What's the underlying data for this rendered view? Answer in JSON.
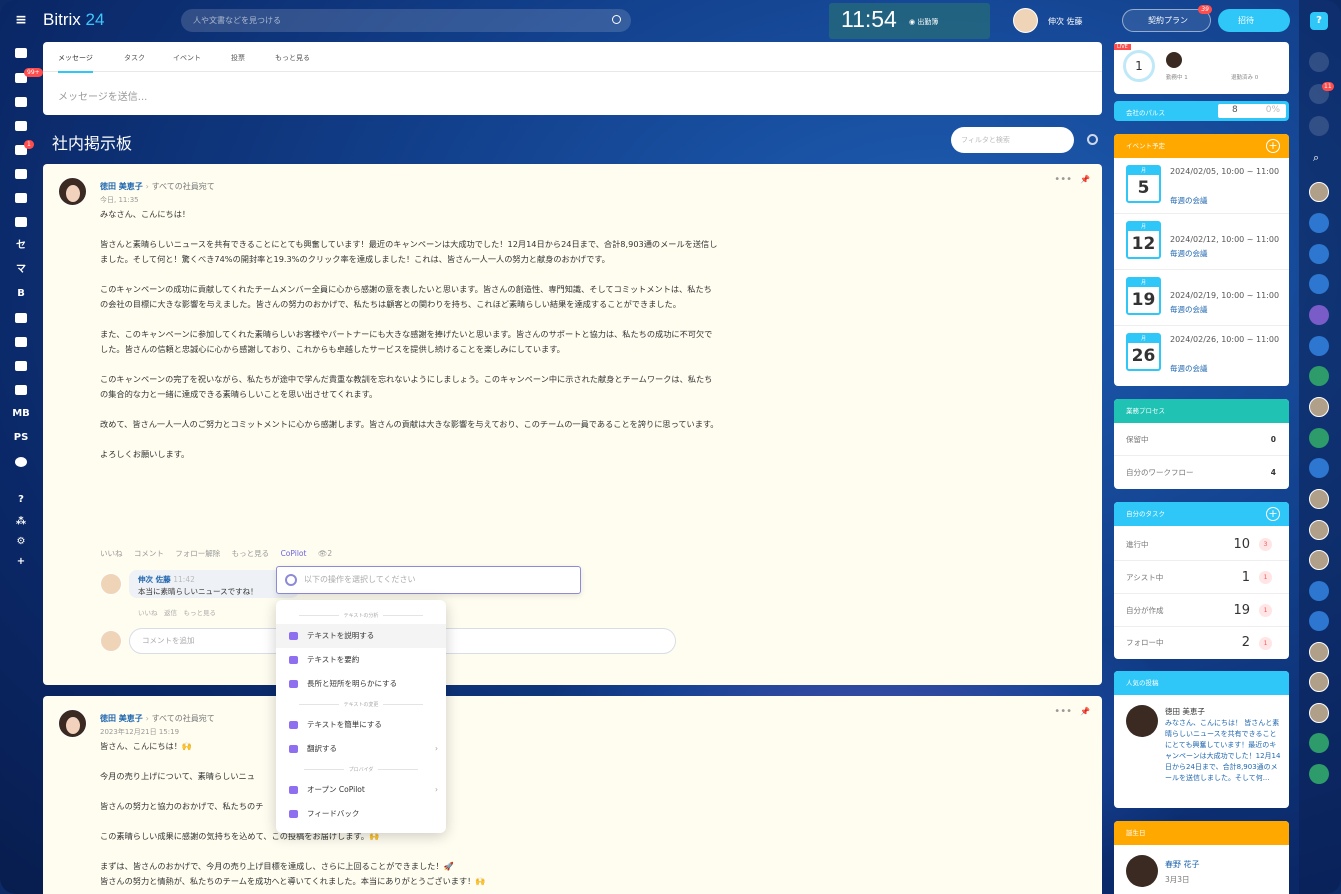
{
  "header": {
    "logo_main": "Bitrix",
    "logo_num": "24",
    "search_placeholder": "人や文書などを見つける",
    "clock": "11:54",
    "clock_status": "出勤簿",
    "user_name": "伸次 佐藤",
    "plan_label": "契約プラン",
    "plan_badge": "39",
    "invite_label": "招待"
  },
  "leftnav": {
    "items": [
      "セ",
      "マ",
      "B",
      "MB",
      "PS"
    ],
    "badge_tasks": "99+",
    "badge_cal": "1"
  },
  "composer": {
    "tabs": [
      "メッセージ",
      "タスク",
      "イベント",
      "投票",
      "もっと見る"
    ],
    "placeholder": "メッセージを送信..."
  },
  "board": {
    "title": "社内掲示板",
    "filter_placeholder": "フィルタと検索"
  },
  "post1": {
    "author": "徳田 美恵子",
    "dest": "すべての社員宛て",
    "date": "今日, 11:35",
    "paragraphs": [
      "みなさん、こんにちは！",
      "皆さんと素晴らしいニュースを共有できることにとても興奮しています！最近のキャンペーンは大成功でした！12月14日から24日まで、合計8,903通のメールを送信しました。そして何と！驚くべき74%の開封率と19.3%のクリック率を達成しました！これは、皆さん一人一人の努力と献身のおかげです。",
      "このキャンペーンの成功に貢献してくれたチームメンバー全員に心から感謝の意を表したいと思います。皆さんの創造性、専門知識、そしてコミットメントは、私たちの会社の目標に大きな影響を与えました。皆さんの努力のおかげで、私たちは顧客との関わりを持ち、これほど素晴らしい結果を達成することができました。",
      "また、このキャンペーンに参加してくれた素晴らしいお客様やパートナーにも大きな感謝を捧げたいと思います。皆さんのサポートと協力は、私たちの成功に不可欠でした。皆さんの信頼と忠誠心に心から感謝しており、これからも卓越したサービスを提供し続けることを楽しみにしています。",
      "このキャンペーンの完了を祝いながら、私たちが途中で学んだ貴重な教訓を忘れないようにしましょう。このキャンペーン中に示された献身とチームワークは、私たちの集合的な力と一緒に達成できる素晴らしいことを思い出させてくれます。",
      "改めて、皆さん一人一人のご努力とコミットメントに心から感謝します。皆さんの貢献は大きな影響を与えており、このチームの一員であることを誇りに思っています。",
      "よろしくお願いします。"
    ],
    "actions": [
      "いいね",
      "コメント",
      "フォロー解除",
      "もっと見る",
      "CoPilot",
      "👁2"
    ],
    "comment_author": "伸次 佐藤",
    "comment_time": "11:42",
    "comment_text": "本当に素晴らしいニュースですね！",
    "comment_actions": "いいね　返信　もっと見る",
    "comment_placeholder": "コメントを追加"
  },
  "copilot": {
    "placeholder": "以下の操作を選択してください",
    "sec1": "テキストの分析",
    "sec2": "テキストの変更",
    "sec3": "プロバイダ",
    "items": [
      "テキストを説明する",
      "テキストを要約",
      "長所と短所を明らかにする",
      "テキストを簡単にする",
      "翻訳する",
      "オープン CoPilot",
      "フィードバック"
    ]
  },
  "post2": {
    "author": "徳田 美恵子",
    "dest": "すべての社員宛て",
    "date": "2023年12月21日 15:19",
    "lines": [
      "皆さん、こんにちは！🙌",
      "今月の売り上げについて、素晴らしいニュ",
      "皆さんの努力と協力のおかげで、私たちのチ",
      "この素晴らしい成果に感謝の気持ちを込めて、この投稿をお届けします。🙌",
      "まずは、皆さんのおかげで、今月の売り上げ目標を達成し、さらに上回ることができました！🚀",
      "皆さんの努力と情熱が、私たちのチームを成功へと導いてくれました。本当にありがとうございます！🙌"
    ]
  },
  "right": {
    "live_count": "1",
    "live_label": "LIVE",
    "online_label": "勤務中 1",
    "off_label": "退勤済み 0",
    "pulse_label": "会社のパルス",
    "pulse_value": "8",
    "pulse_percent": "0%",
    "events_title": "イベント予定",
    "events": [
      {
        "month": "月",
        "day": "5",
        "when": "2024/02/05, 10:00 ~ 11:00",
        "what": "毎週の会議"
      },
      {
        "month": "月",
        "day": "12",
        "when": "2024/02/12, 10:00 ~ 11:00",
        "what": "毎週の会議"
      },
      {
        "month": "月",
        "day": "19",
        "when": "2024/02/19, 10:00 ~ 11:00",
        "what": "毎週の会議"
      },
      {
        "month": "月",
        "day": "26",
        "when": "2024/02/26, 10:00 ~ 11:00",
        "what": "毎週の会議"
      }
    ],
    "process_title": "業務プロセス",
    "process": [
      {
        "label": "保留中",
        "value": "0"
      },
      {
        "label": "自分のワークフロー",
        "value": "4"
      }
    ],
    "tasks_title": "自分のタスク",
    "tasks": [
      {
        "label": "進行中",
        "value": "10",
        "cnt": "3"
      },
      {
        "label": "アシスト中",
        "value": "1",
        "cnt": "1"
      },
      {
        "label": "自分が作成",
        "value": "19",
        "cnt": "1"
      },
      {
        "label": "フォロー中",
        "value": "2",
        "cnt": "1"
      }
    ],
    "popular_title": "人気の投稿",
    "popular_author": "徳田 美恵子",
    "popular_text": "みなさん、こんにちは！ 皆さんと素晴らしいニュースを共有できることにとても興奮しています！最近のキャンペーンは大成功でした！12月14日から24日まで、合計8,903通のメールを送信しました。そして何...",
    "birthday_title": "誕生日",
    "birthday_name": "春野 花子",
    "birthday_date": "3月3日"
  },
  "rail": {
    "help": "?",
    "bell_badge": "11"
  }
}
